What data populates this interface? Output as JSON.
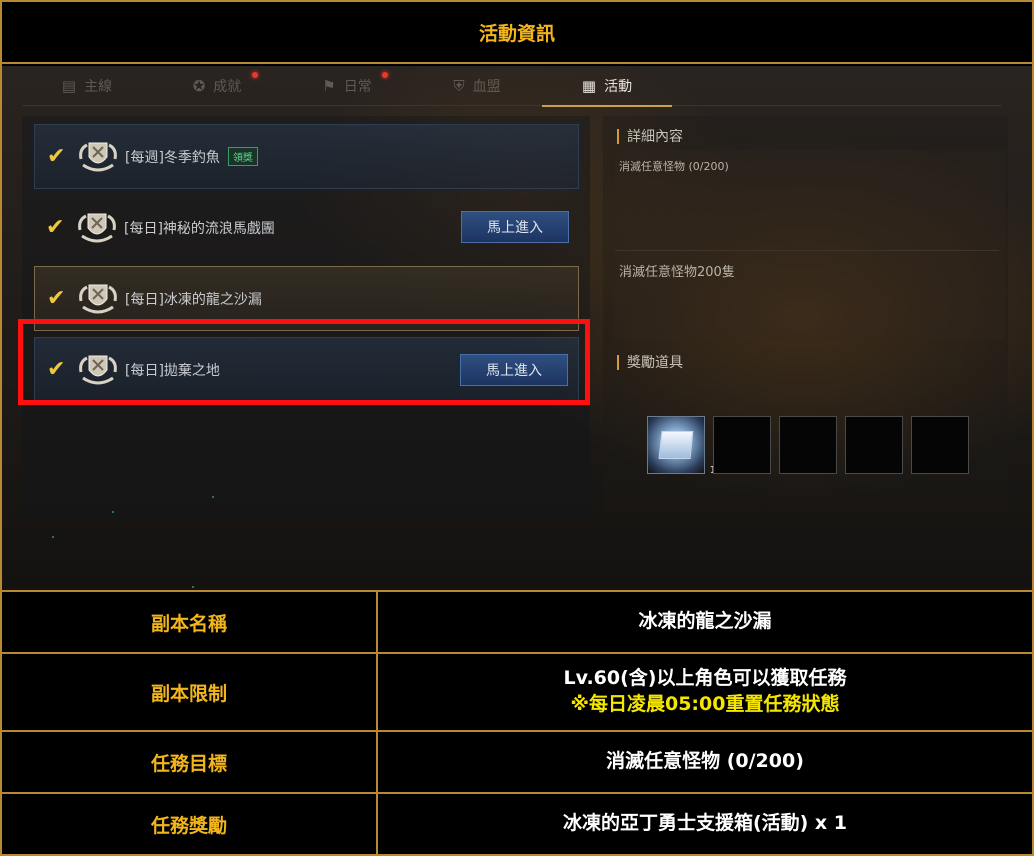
{
  "header": {
    "title": "活動資訊"
  },
  "tabs": [
    {
      "label": "主線",
      "icon": "scroll-icon",
      "glyph": "▤",
      "active": false,
      "badge": false
    },
    {
      "label": "成就",
      "icon": "medal-icon",
      "glyph": "✪",
      "active": false,
      "badge": true
    },
    {
      "label": "日常",
      "icon": "flag-icon",
      "glyph": "⚑",
      "active": false,
      "badge": true
    },
    {
      "label": "血盟",
      "icon": "shield-icon",
      "glyph": "⛨",
      "active": false,
      "badge": false
    },
    {
      "label": "活動",
      "icon": "gift-icon",
      "glyph": "🎁",
      "active": true,
      "badge": false
    }
  ],
  "quests": [
    {
      "name": "[每週]冬季釣魚",
      "tag": "領獎",
      "button": "",
      "selected": false
    },
    {
      "name": "[每日]神秘的流浪馬戲團",
      "tag": "",
      "button": "馬上進入",
      "selected": false
    },
    {
      "name": "[每日]冰凍的龍之沙漏",
      "tag": "",
      "button": "",
      "selected": true
    },
    {
      "name": "[每日]拋棄之地",
      "tag": "",
      "button": "馬上進入",
      "selected": false
    }
  ],
  "detail": {
    "section_title": "詳細內容",
    "progress": "消滅任意怪物 (0/200)",
    "description": "消滅任意怪物200隻",
    "reward_title": "獎勵道具",
    "reward_slots": [
      {
        "filled": true,
        "count": "1",
        "icon": "silver-chest-icon"
      },
      {
        "filled": false,
        "count": ""
      },
      {
        "filled": false,
        "count": ""
      },
      {
        "filled": false,
        "count": ""
      },
      {
        "filled": false,
        "count": ""
      }
    ]
  },
  "colors": {
    "gold": "#f2b51c",
    "border": "#b8892f",
    "highlight": "#ff1010",
    "note": "#f5e600"
  },
  "info_table": [
    {
      "label": "副本名稱",
      "value": "冰凍的龍之沙漏",
      "note": ""
    },
    {
      "label": "副本限制",
      "value": "Lv.60(含)以上角色可以獲取任務",
      "note": "※每日凌晨05:00重置任務狀態"
    },
    {
      "label": "任務目標",
      "value": "消滅任意怪物 (0/200)",
      "note": ""
    },
    {
      "label": "任務獎勵",
      "value": "冰凍的亞丁勇士支援箱(活動) x 1",
      "note": ""
    }
  ]
}
